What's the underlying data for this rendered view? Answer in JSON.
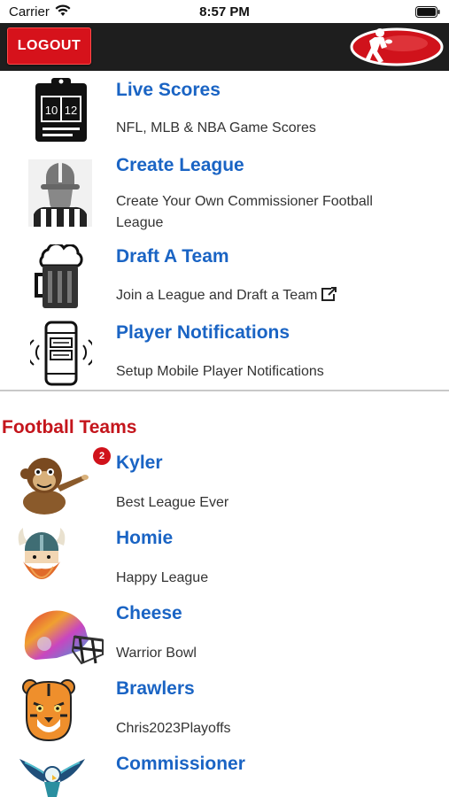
{
  "status_bar": {
    "carrier": "Carrier",
    "time": "8:57 PM"
  },
  "header": {
    "logout_label": "LOGOUT",
    "logo_icon": "football-player-logo-icon"
  },
  "menu": [
    {
      "title": "Live Scores",
      "description": "NFL, MLB & NBA Game Scores",
      "icon": "scoreboard-clipboard-icon"
    },
    {
      "title": "Create League",
      "description": "Create Your Own Commissioner Football League",
      "icon": "referee-icon"
    },
    {
      "title": "Draft A Team",
      "description": "Join a League and Draft a Team",
      "icon": "beer-mug-icon"
    },
    {
      "title": "Player Notifications",
      "description": "Setup Mobile Player Notifications",
      "icon": "phone-notification-icon"
    }
  ],
  "section": {
    "title": "Football Teams"
  },
  "teams": [
    {
      "name": "Kyler",
      "league": "Best League Ever",
      "badge": "2",
      "icon": "monkey-avatar-icon"
    },
    {
      "name": "Homie",
      "league": "Happy League",
      "icon": "viking-avatar-icon"
    },
    {
      "name": "Cheese",
      "league": "Warrior Bowl",
      "icon": "helmet-avatar-icon"
    },
    {
      "name": "Brawlers",
      "league": "Chris2023Playoffs",
      "icon": "tiger-avatar-icon"
    },
    {
      "name": "Commissioner",
      "league": "",
      "icon": "eagle-avatar-icon"
    }
  ],
  "colors": {
    "accent_red": "#d6121b",
    "link_blue": "#1a64c4",
    "topbar": "#1e1e1e"
  }
}
